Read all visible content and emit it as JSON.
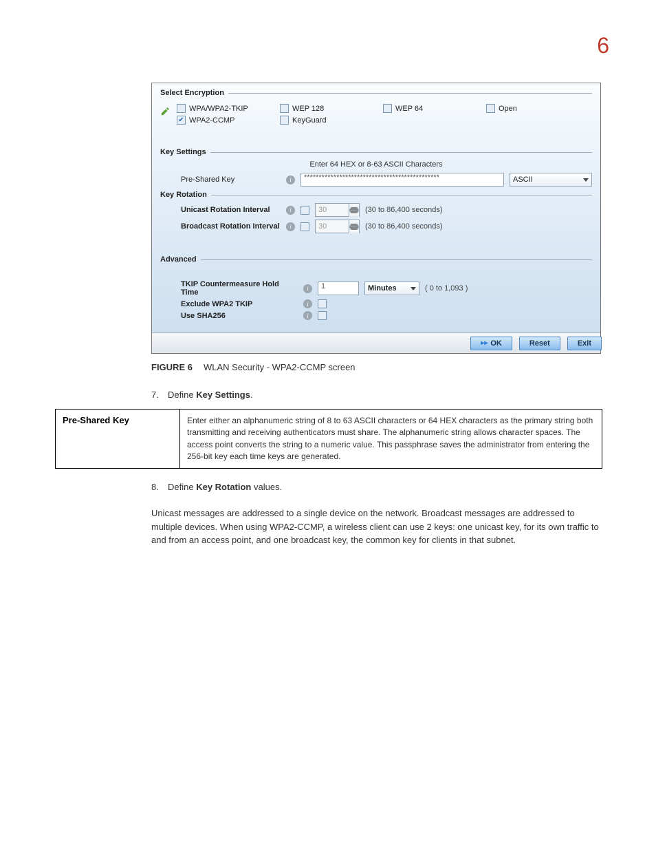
{
  "page_number": "6",
  "screenshot": {
    "select_encryption": {
      "title": "Select Encryption",
      "options": [
        {
          "label": "WPA/WPA2-TKIP",
          "checked": false
        },
        {
          "label": "WPA2-CCMP",
          "checked": true
        },
        {
          "label": "WEP 128",
          "checked": false
        },
        {
          "label": "KeyGuard",
          "checked": false
        },
        {
          "label": "WEP 64",
          "checked": false
        },
        {
          "label": "Open",
          "checked": false
        }
      ]
    },
    "key_settings": {
      "title": "Key Settings",
      "hint": "Enter 64 HEX or 8-63 ASCII Characters",
      "psk_label": "Pre-Shared Key",
      "psk_value": "**********************************************",
      "psk_format": "ASCII"
    },
    "key_rotation": {
      "title": "Key Rotation",
      "unicast_label": "Unicast Rotation Interval",
      "unicast_value": "30",
      "unicast_hint": "(30 to 86,400 seconds)",
      "broadcast_label": "Broadcast Rotation Interval",
      "broadcast_value": "30",
      "broadcast_hint": "(30 to 86,400 seconds)"
    },
    "advanced": {
      "title": "Advanced",
      "tkip_label": "TKIP Countermeasure Hold Time",
      "tkip_value": "1",
      "tkip_unit": "Minutes",
      "tkip_hint": "( 0 to 1,093 )",
      "exclude_label": "Exclude WPA2 TKIP",
      "sha_label": "Use SHA256"
    },
    "buttons": {
      "ok": "OK",
      "reset": "Reset",
      "exit": "Exit"
    }
  },
  "caption": {
    "figure": "FIGURE 6",
    "title": "WLAN Security - WPA2-CCMP screen"
  },
  "steps": {
    "s7_num": "7.",
    "s7_a": "Define ",
    "s7_b": "Key Settings",
    "s7_c": ".",
    "s8_num": "8.",
    "s8_a": "Define ",
    "s8_b": "Key Rotation",
    "s8_c": " values."
  },
  "table": {
    "header": "Pre-Shared Key",
    "body": "Enter either an alphanumeric string of 8 to 63 ASCII characters or 64 HEX characters as the primary string both transmitting and receiving authenticators must share. The alphanumeric string allows character spaces. The access point converts the string to a numeric value. This passphrase saves the administrator from entering the 256-bit key each time keys are generated."
  },
  "paragraph": "Unicast messages are addressed to a single device on the network. Broadcast messages are addressed to multiple devices. When using WPA2-CCMP, a wireless client can use 2 keys: one unicast key, for its own traffic to and from an access point, and one broadcast key, the common key for clients in that subnet."
}
